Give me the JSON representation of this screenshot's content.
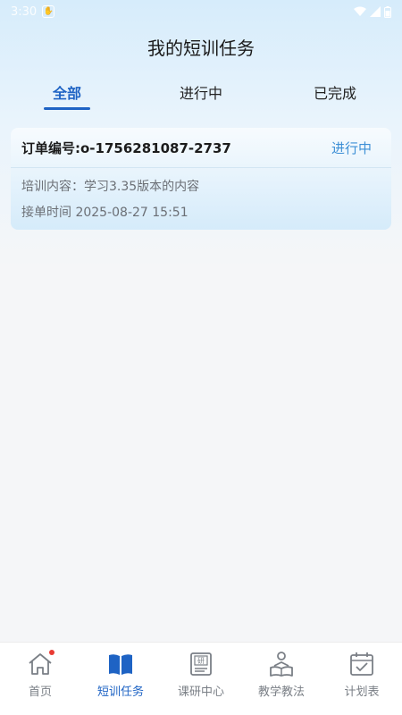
{
  "status_bar": {
    "time": "3:30"
  },
  "header": {
    "title": "我的短训任务"
  },
  "tabs": [
    {
      "label": "全部",
      "active": true
    },
    {
      "label": "进行中",
      "active": false
    },
    {
      "label": "已完成",
      "active": false
    }
  ],
  "orders": [
    {
      "order_no": "订单编号:o-1756281087-2737",
      "status": "进行中",
      "content": "培训内容：学习3.35版本的内容",
      "time": "接单时间 2025-08-27 15:51"
    }
  ],
  "bottom_nav": [
    {
      "label": "首页",
      "icon": "home-icon",
      "active": false,
      "badge": true
    },
    {
      "label": "短训任务",
      "icon": "book-icon",
      "active": true,
      "badge": false
    },
    {
      "label": "课研中心",
      "icon": "research-icon",
      "active": false,
      "badge": false
    },
    {
      "label": "教学教法",
      "icon": "teacher-icon",
      "active": false,
      "badge": false
    },
    {
      "label": "计划表",
      "icon": "calendar-check-icon",
      "active": false,
      "badge": false
    }
  ],
  "colors": {
    "accent": "#1e63c4",
    "status_in_progress": "#3d8fd6",
    "badge": "#e93b33"
  }
}
